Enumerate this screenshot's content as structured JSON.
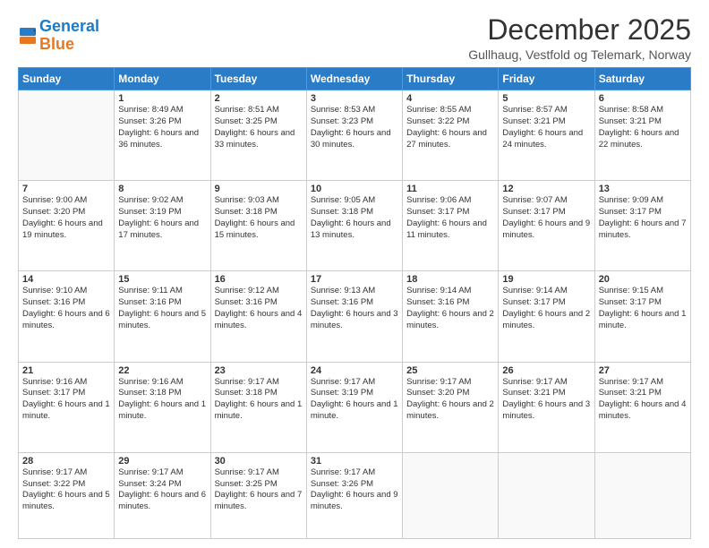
{
  "header": {
    "logo_line1": "General",
    "logo_line2": "Blue",
    "month": "December 2025",
    "location": "Gullhaug, Vestfold og Telemark, Norway"
  },
  "weekdays": [
    "Sunday",
    "Monday",
    "Tuesday",
    "Wednesday",
    "Thursday",
    "Friday",
    "Saturday"
  ],
  "weeks": [
    [
      {
        "day": "",
        "sunrise": "",
        "sunset": "",
        "daylight": ""
      },
      {
        "day": "1",
        "sunrise": "Sunrise: 8:49 AM",
        "sunset": "Sunset: 3:26 PM",
        "daylight": "Daylight: 6 hours and 36 minutes."
      },
      {
        "day": "2",
        "sunrise": "Sunrise: 8:51 AM",
        "sunset": "Sunset: 3:25 PM",
        "daylight": "Daylight: 6 hours and 33 minutes."
      },
      {
        "day": "3",
        "sunrise": "Sunrise: 8:53 AM",
        "sunset": "Sunset: 3:23 PM",
        "daylight": "Daylight: 6 hours and 30 minutes."
      },
      {
        "day": "4",
        "sunrise": "Sunrise: 8:55 AM",
        "sunset": "Sunset: 3:22 PM",
        "daylight": "Daylight: 6 hours and 27 minutes."
      },
      {
        "day": "5",
        "sunrise": "Sunrise: 8:57 AM",
        "sunset": "Sunset: 3:21 PM",
        "daylight": "Daylight: 6 hours and 24 minutes."
      },
      {
        "day": "6",
        "sunrise": "Sunrise: 8:58 AM",
        "sunset": "Sunset: 3:21 PM",
        "daylight": "Daylight: 6 hours and 22 minutes."
      }
    ],
    [
      {
        "day": "7",
        "sunrise": "Sunrise: 9:00 AM",
        "sunset": "Sunset: 3:20 PM",
        "daylight": "Daylight: 6 hours and 19 minutes."
      },
      {
        "day": "8",
        "sunrise": "Sunrise: 9:02 AM",
        "sunset": "Sunset: 3:19 PM",
        "daylight": "Daylight: 6 hours and 17 minutes."
      },
      {
        "day": "9",
        "sunrise": "Sunrise: 9:03 AM",
        "sunset": "Sunset: 3:18 PM",
        "daylight": "Daylight: 6 hours and 15 minutes."
      },
      {
        "day": "10",
        "sunrise": "Sunrise: 9:05 AM",
        "sunset": "Sunset: 3:18 PM",
        "daylight": "Daylight: 6 hours and 13 minutes."
      },
      {
        "day": "11",
        "sunrise": "Sunrise: 9:06 AM",
        "sunset": "Sunset: 3:17 PM",
        "daylight": "Daylight: 6 hours and 11 minutes."
      },
      {
        "day": "12",
        "sunrise": "Sunrise: 9:07 AM",
        "sunset": "Sunset: 3:17 PM",
        "daylight": "Daylight: 6 hours and 9 minutes."
      },
      {
        "day": "13",
        "sunrise": "Sunrise: 9:09 AM",
        "sunset": "Sunset: 3:17 PM",
        "daylight": "Daylight: 6 hours and 7 minutes."
      }
    ],
    [
      {
        "day": "14",
        "sunrise": "Sunrise: 9:10 AM",
        "sunset": "Sunset: 3:16 PM",
        "daylight": "Daylight: 6 hours and 6 minutes."
      },
      {
        "day": "15",
        "sunrise": "Sunrise: 9:11 AM",
        "sunset": "Sunset: 3:16 PM",
        "daylight": "Daylight: 6 hours and 5 minutes."
      },
      {
        "day": "16",
        "sunrise": "Sunrise: 9:12 AM",
        "sunset": "Sunset: 3:16 PM",
        "daylight": "Daylight: 6 hours and 4 minutes."
      },
      {
        "day": "17",
        "sunrise": "Sunrise: 9:13 AM",
        "sunset": "Sunset: 3:16 PM",
        "daylight": "Daylight: 6 hours and 3 minutes."
      },
      {
        "day": "18",
        "sunrise": "Sunrise: 9:14 AM",
        "sunset": "Sunset: 3:16 PM",
        "daylight": "Daylight: 6 hours and 2 minutes."
      },
      {
        "day": "19",
        "sunrise": "Sunrise: 9:14 AM",
        "sunset": "Sunset: 3:17 PM",
        "daylight": "Daylight: 6 hours and 2 minutes."
      },
      {
        "day": "20",
        "sunrise": "Sunrise: 9:15 AM",
        "sunset": "Sunset: 3:17 PM",
        "daylight": "Daylight: 6 hours and 1 minute."
      }
    ],
    [
      {
        "day": "21",
        "sunrise": "Sunrise: 9:16 AM",
        "sunset": "Sunset: 3:17 PM",
        "daylight": "Daylight: 6 hours and 1 minute."
      },
      {
        "day": "22",
        "sunrise": "Sunrise: 9:16 AM",
        "sunset": "Sunset: 3:18 PM",
        "daylight": "Daylight: 6 hours and 1 minute."
      },
      {
        "day": "23",
        "sunrise": "Sunrise: 9:17 AM",
        "sunset": "Sunset: 3:18 PM",
        "daylight": "Daylight: 6 hours and 1 minute."
      },
      {
        "day": "24",
        "sunrise": "Sunrise: 9:17 AM",
        "sunset": "Sunset: 3:19 PM",
        "daylight": "Daylight: 6 hours and 1 minute."
      },
      {
        "day": "25",
        "sunrise": "Sunrise: 9:17 AM",
        "sunset": "Sunset: 3:20 PM",
        "daylight": "Daylight: 6 hours and 2 minutes."
      },
      {
        "day": "26",
        "sunrise": "Sunrise: 9:17 AM",
        "sunset": "Sunset: 3:21 PM",
        "daylight": "Daylight: 6 hours and 3 minutes."
      },
      {
        "day": "27",
        "sunrise": "Sunrise: 9:17 AM",
        "sunset": "Sunset: 3:21 PM",
        "daylight": "Daylight: 6 hours and 4 minutes."
      }
    ],
    [
      {
        "day": "28",
        "sunrise": "Sunrise: 9:17 AM",
        "sunset": "Sunset: 3:22 PM",
        "daylight": "Daylight: 6 hours and 5 minutes."
      },
      {
        "day": "29",
        "sunrise": "Sunrise: 9:17 AM",
        "sunset": "Sunset: 3:24 PM",
        "daylight": "Daylight: 6 hours and 6 minutes."
      },
      {
        "day": "30",
        "sunrise": "Sunrise: 9:17 AM",
        "sunset": "Sunset: 3:25 PM",
        "daylight": "Daylight: 6 hours and 7 minutes."
      },
      {
        "day": "31",
        "sunrise": "Sunrise: 9:17 AM",
        "sunset": "Sunset: 3:26 PM",
        "daylight": "Daylight: 6 hours and 9 minutes."
      },
      {
        "day": "",
        "sunrise": "",
        "sunset": "",
        "daylight": ""
      },
      {
        "day": "",
        "sunrise": "",
        "sunset": "",
        "daylight": ""
      },
      {
        "day": "",
        "sunrise": "",
        "sunset": "",
        "daylight": ""
      }
    ]
  ]
}
